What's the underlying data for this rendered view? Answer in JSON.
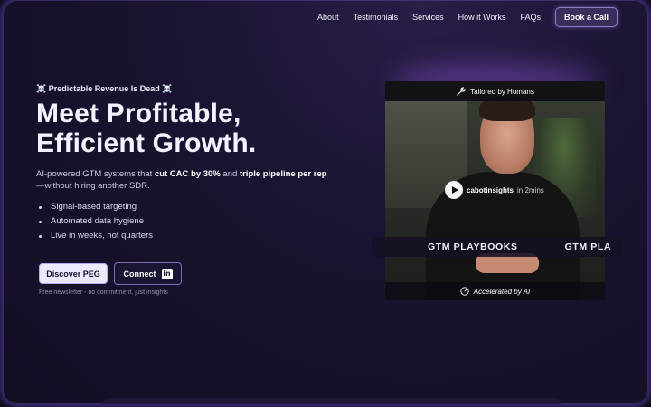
{
  "nav": {
    "links": [
      "About",
      "Testimonials",
      "Services",
      "How it Works",
      "FAQs"
    ],
    "cta": "Book a Call"
  },
  "hero": {
    "kicker": "☠️ Predictable Revenue Is Dead ☠️",
    "headline_line1": "Meet Profitable,",
    "headline_line2": "Efficient Growth.",
    "sub_pre": "AI-powered GTM systems that ",
    "sub_bold1": "cut CAC by 30%",
    "sub_mid": " and ",
    "sub_bold2": "triple pipeline per rep",
    "sub_post": "—without hiring another SDR.",
    "bullets": [
      "Signal-based targeting",
      "Automated data hygiene",
      "Live in weeks, not quarters"
    ],
    "discover_label": "Discover PEG",
    "connect_label": "Connect",
    "note": "Free newsletter - no commitment, just insights"
  },
  "video": {
    "top_label": "Tailored by Humans",
    "handle": "cabotinsights",
    "duration": "in 2mins",
    "ribbon_items": [
      "GTM PLAYBOOKS",
      "GTM PLA"
    ],
    "bottom_label": "Accelerated by AI"
  },
  "colors": {
    "accent_glow": "#7e57ff",
    "background": "#140e24",
    "button_light": "#ede8fb"
  }
}
